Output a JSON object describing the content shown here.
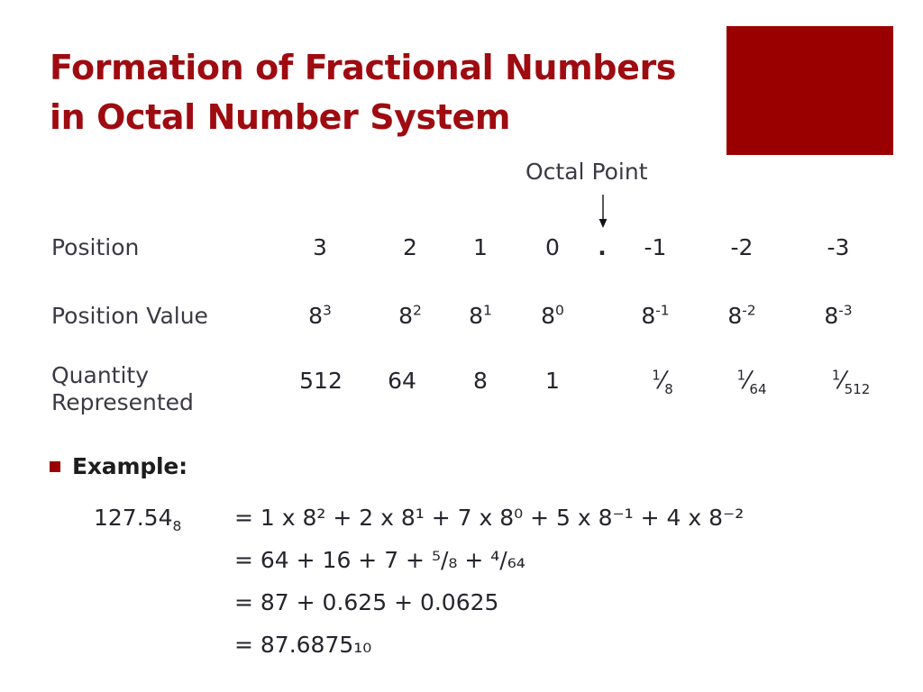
{
  "slide": {
    "title_lines": [
      "Formation of Fractional Numbers",
      "in Octal Number System"
    ],
    "title_color": "#9E0B10",
    "decor_block_color": "#9B0000",
    "background_color": "#ffffff"
  },
  "callout": {
    "label": "Octal Point",
    "arrow_icon": "down-arrow-icon"
  },
  "table": {
    "row_labels": {
      "position": "Position",
      "position_value": "Position Value",
      "quantity_represented": "Quantity\nRepresented"
    },
    "columns": [
      {
        "position": "3",
        "position_value_base": "8",
        "position_value_exp": "3",
        "quantity": "512",
        "quantity_type": "plain"
      },
      {
        "position": "2",
        "position_value_base": "8",
        "position_value_exp": "2",
        "quantity": "64",
        "quantity_type": "plain"
      },
      {
        "position": "1",
        "position_value_base": "8",
        "position_value_exp": "1",
        "quantity": "8",
        "quantity_type": "plain"
      },
      {
        "position": "0",
        "position_value_base": "8",
        "position_value_exp": "0",
        "quantity": "1",
        "quantity_type": "plain"
      },
      {
        "position": "-1",
        "position_value_base": "8",
        "position_value_exp": "-1",
        "quantity_num": "1",
        "quantity_den": "8",
        "quantity_type": "fraction"
      },
      {
        "position": "-2",
        "position_value_base": "8",
        "position_value_exp": "-2",
        "quantity_num": "1",
        "quantity_den": "64",
        "quantity_type": "fraction"
      },
      {
        "position": "-3",
        "position_value_base": "8",
        "position_value_exp": "-3",
        "quantity_num": "1",
        "quantity_den": "512",
        "quantity_type": "fraction"
      }
    ],
    "octal_point_marker": "."
  },
  "example": {
    "bullet_label": "Example",
    "bullet_colon": ":",
    "bullet_color": "#9B0000",
    "number_lhs_base": "127.54",
    "number_lhs_sub": "8",
    "lines": [
      {
        "lhs": "127.54",
        "lhs_sub": "8",
        "rhs": "= 1 x 8² + 2 x 8¹ + 7 x 8⁰ + 5 x 8⁻¹ + 4 x 8⁻²"
      },
      {
        "lhs": "",
        "lhs_sub": "",
        "rhs": "= 64 + 16 + 7 + ⁵/₈ + ⁴/₆₄"
      },
      {
        "lhs": "",
        "lhs_sub": "",
        "rhs": "= 87 + 0.625 + 0.0625"
      },
      {
        "lhs": "",
        "lhs_sub": "",
        "rhs": "= 87.6875₁₀"
      }
    ]
  }
}
